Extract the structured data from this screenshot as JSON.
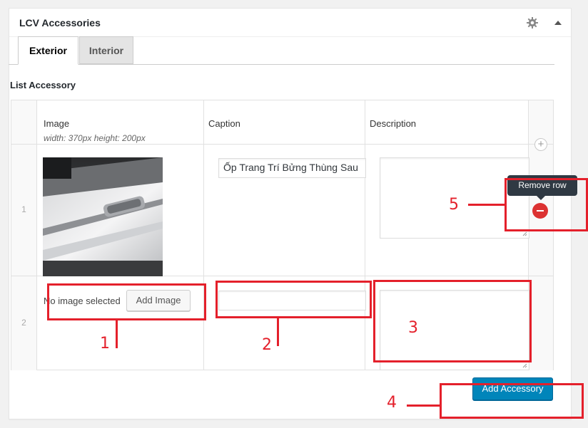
{
  "panel": {
    "title": "LCV Accessories",
    "gear_icon": "gear-icon",
    "toggle_icon": "caret-up-icon"
  },
  "tabs": [
    {
      "label": "Exterior",
      "active": true
    },
    {
      "label": "Interior",
      "active": false
    }
  ],
  "field": {
    "label": "List Accessory"
  },
  "table": {
    "columns": [
      {
        "label": "Image",
        "hint": "width: 370px height: 200px"
      },
      {
        "label": "Caption"
      },
      {
        "label": "Description"
      }
    ],
    "rows": [
      {
        "order": "1",
        "image": "car-door-photo",
        "caption": "Ốp Trang Trí Bửng Thùng Sau",
        "description": ""
      },
      {
        "order": "2",
        "image_status": "No image selected",
        "add_image_label": "Add Image",
        "caption": "",
        "description": ""
      }
    ]
  },
  "tooltip": {
    "text": "Remove row"
  },
  "add_button": {
    "label": "Add Accessory"
  },
  "annotations": [
    "1",
    "2",
    "3",
    "4",
    "5"
  ],
  "colors": {
    "accent": "#0085ba",
    "annotation": "#e4202b",
    "remove": "#dc3232"
  }
}
